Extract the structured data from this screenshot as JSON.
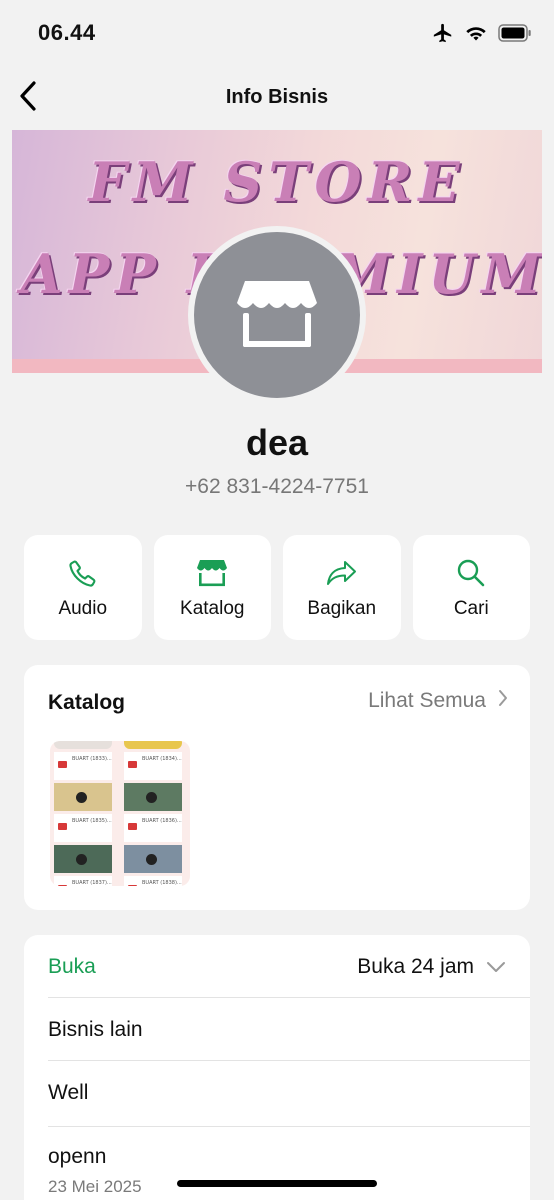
{
  "status": {
    "time": "06.44",
    "icons": [
      "airplane-icon",
      "wifi-icon",
      "battery-icon"
    ]
  },
  "header": {
    "title": "Info Bisnis",
    "back_icon": "chevron-left-icon"
  },
  "cover": {
    "line1": "FM STORE",
    "line2": "APP PREMIUM"
  },
  "profile": {
    "name": "dea",
    "phone": "+62 831-4224-7751",
    "avatar_icon": "store-icon"
  },
  "actions": [
    {
      "label": "Audio",
      "icon": "phone-icon"
    },
    {
      "label": "Katalog",
      "icon": "store-icon"
    },
    {
      "label": "Bagikan",
      "icon": "share-icon"
    },
    {
      "label": "Cari",
      "icon": "search-icon"
    }
  ],
  "catalog": {
    "title": "Katalog",
    "see_all": "Lihat Semua",
    "thumb_items": [
      "BUART (1833)...",
      "BUART (1834)...",
      "BUART (1835)...",
      "BUART (1836)...",
      "BUART (1837)...",
      "BUART (1838)..."
    ]
  },
  "info": {
    "status_label": "Buka",
    "hours_value": "Buka 24 jam",
    "category": "Bisnis lain",
    "description": "Well",
    "post_title": "openn",
    "post_date": "23 Mei 2025"
  },
  "colors": {
    "accent": "#1a9e55",
    "background": "#f2f2f2",
    "card": "#ffffff",
    "secondary_text": "#7a7a7a"
  }
}
